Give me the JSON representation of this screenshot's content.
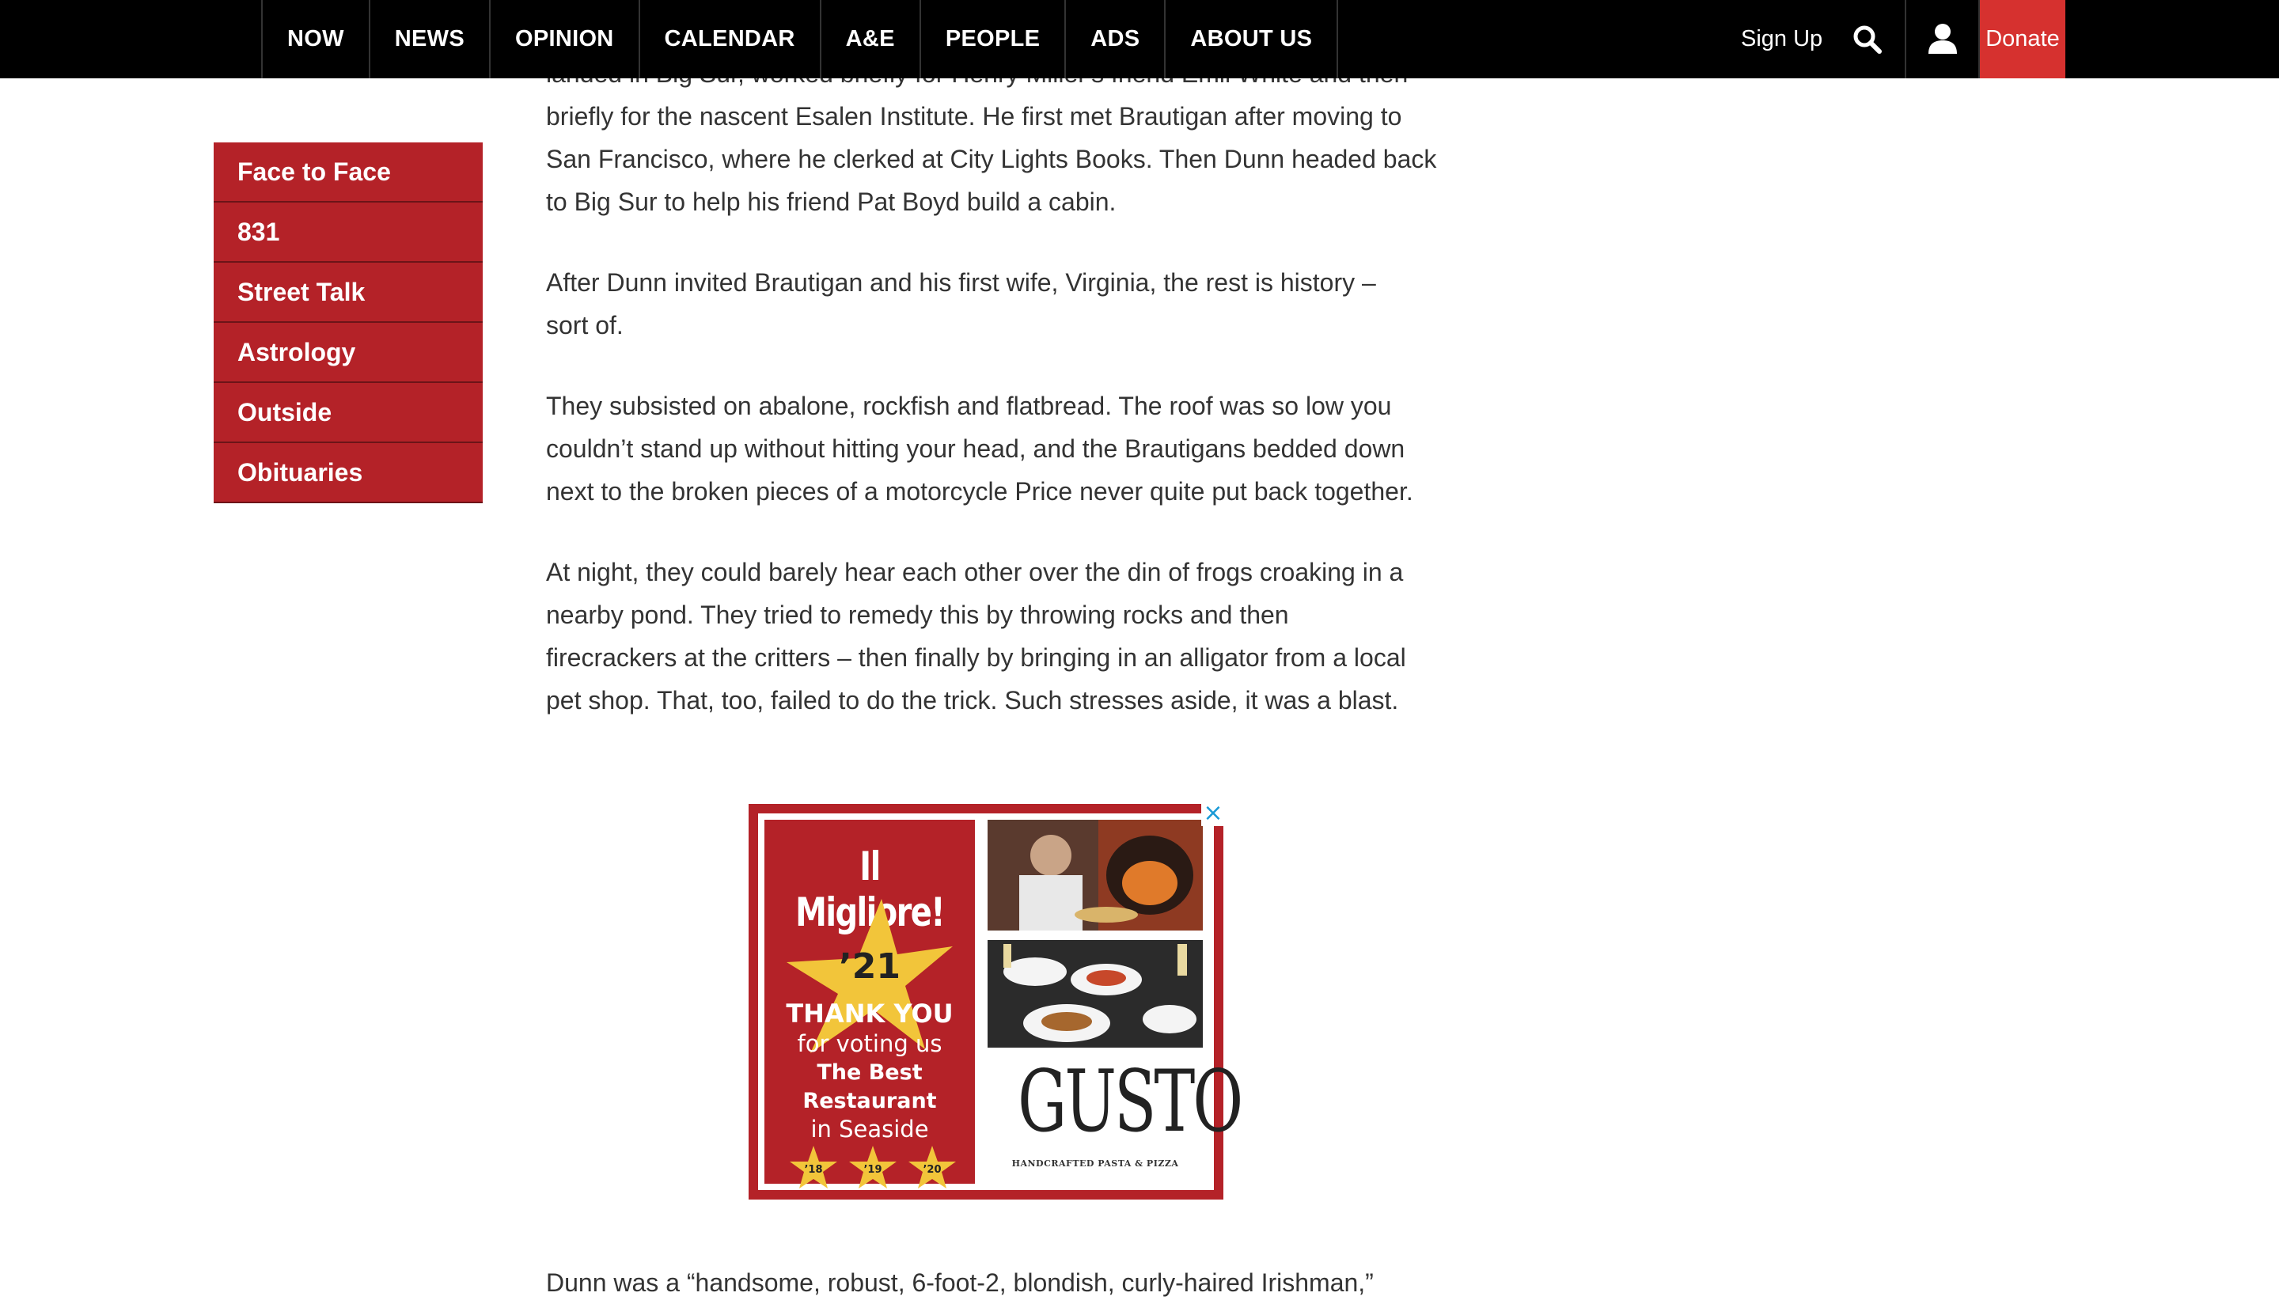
{
  "nav": {
    "items": [
      {
        "label": "NOW"
      },
      {
        "label": "NEWS"
      },
      {
        "label": "OPINION"
      },
      {
        "label": "CALENDAR"
      },
      {
        "label": "A&E"
      },
      {
        "label": "PEOPLE"
      },
      {
        "label": "ADS"
      },
      {
        "label": "ABOUT US"
      }
    ],
    "signup_label": "Sign Up",
    "donate_label": "Donate",
    "search_icon": "search-icon",
    "user_icon": "user-icon",
    "accent_color": "#d6312f"
  },
  "sidebar": {
    "items": [
      {
        "label": "Face to Face"
      },
      {
        "label": "831"
      },
      {
        "label": "Street Talk"
      },
      {
        "label": "Astrology"
      },
      {
        "label": "Outside"
      },
      {
        "label": "Obituaries"
      }
    ],
    "color": "#b42228"
  },
  "article": {
    "p0_clipped": "landed in Big Sur, worked briefly for Henry Miller's friend Emil White and then briefly for the nascent Esalen Institute. He first met Brautigan after moving to San Francisco, where he clerked at City Lights Books. Then Dunn headed back to Big Sur to help his friend Pat Boyd build a cabin.",
    "p1": "After Dunn invited Brautigan and his first wife, Virginia, the rest is history – sort of.",
    "p2": "They subsisted on abalone, rockfish and flatbread. The roof was so low you couldn’t stand up without hitting your head, and the Brautigans bedded down next to the broken pieces of a motorcycle Price never quite put back together.",
    "p3": "At night, they could barely hear each other over the din of frogs croaking in a nearby pond. They tried to remedy this by throwing rocks and then firecrackers at the critters – then finally by bringing in an alligator from a local pet shop. That, too, failed to do the trick. Such stresses aside, it was a blast.",
    "p4": "Dunn was a “handsome, robust, 6-foot-2, blondish, curly-haired Irishman,”"
  },
  "ad": {
    "headline": "Il Migliore!",
    "year": "’21",
    "thanks": "THANK YOU",
    "voting": "for voting us",
    "best": "The Best Restaurant",
    "seaside": "in Seaside",
    "years": [
      "’18",
      "’19",
      "’20"
    ],
    "logo": "GUSTO",
    "tagline": "HANDCRAFTED PASTA & PIZZA",
    "close_icon": "close-icon"
  }
}
